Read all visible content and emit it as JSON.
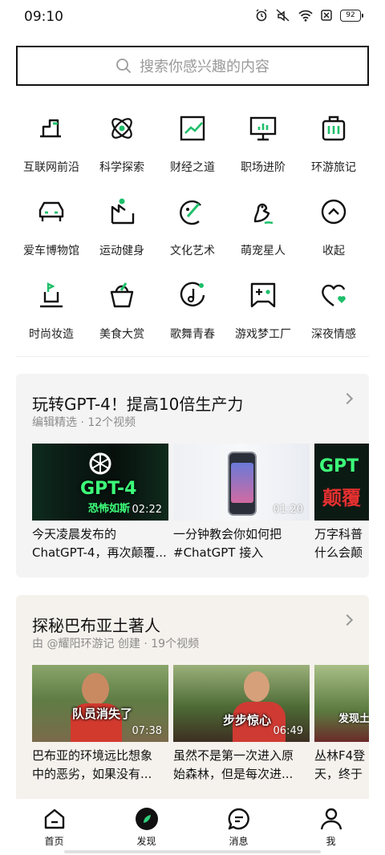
{
  "status": {
    "time": "09:10",
    "battery": "92",
    "icons": [
      "alarm-icon",
      "mute-icon",
      "wifi-icon",
      "sim-off-icon",
      "battery-icon"
    ]
  },
  "search": {
    "placeholder": "搜索你感兴趣的内容",
    "icon": "search-icon"
  },
  "categories": [
    {
      "label": "互联网前沿",
      "icon": "internet-icon"
    },
    {
      "label": "科学探索",
      "icon": "science-icon"
    },
    {
      "label": "财经之道",
      "icon": "finance-icon"
    },
    {
      "label": "职场进阶",
      "icon": "career-icon"
    },
    {
      "label": "环游旅记",
      "icon": "travel-icon"
    },
    {
      "label": "爱车博物馆",
      "icon": "car-icon"
    },
    {
      "label": "运动健身",
      "icon": "sports-icon"
    },
    {
      "label": "文化艺术",
      "icon": "art-icon"
    },
    {
      "label": "萌宠星人",
      "icon": "pet-icon"
    },
    {
      "label": "收起",
      "icon": "collapse-icon"
    },
    {
      "label": "时尚妆造",
      "icon": "fashion-icon"
    },
    {
      "label": "美食大赏",
      "icon": "food-icon"
    },
    {
      "label": "歌舞青春",
      "icon": "music-icon"
    },
    {
      "label": "游戏梦工厂",
      "icon": "game-icon"
    },
    {
      "label": "深夜情感",
      "icon": "emotion-icon"
    }
  ],
  "collections": [
    {
      "title": "玩转GPT-4！提高10倍生产力",
      "subtitle": "编辑精选 · 12个视频",
      "videos": [
        {
          "title": "今天凌晨发布的\nChatGPT-4，再次颠覆...",
          "duration": "02:22",
          "overlay": "GPT-4",
          "overlay_sub": "恐怖如斯"
        },
        {
          "title": "一分钟教会你如何把\n#ChatGPT 接入",
          "duration": "01:20"
        },
        {
          "title": "万字科普\n什么会颠",
          "overlay": "GPT",
          "overlay_sub": "颠覆"
        }
      ]
    },
    {
      "title": "探秘巴布亚土著人",
      "subtitle": "由 @耀阳环游记 创建 · 19个视频",
      "videos": [
        {
          "title": "巴布亚的环境远比想象\n中的恶劣，如果没有...",
          "duration": "07:38",
          "overlay": "队员消失了"
        },
        {
          "title": "虽然不是第一次进入原\n始森林，但是每次进...",
          "duration": "06:49",
          "overlay": "步步惊心"
        },
        {
          "title": "丛林F4登\n天，终于",
          "overlay": "发现土"
        }
      ]
    }
  ],
  "nav": [
    {
      "label": "首页",
      "icon": "home-icon"
    },
    {
      "label": "发现",
      "icon": "discover-icon"
    },
    {
      "label": "消息",
      "icon": "message-icon"
    },
    {
      "label": "我",
      "icon": "profile-icon"
    }
  ],
  "colors": {
    "accent": "#1fbf6a",
    "text": "#111111",
    "subtle": "#8c8c8c"
  }
}
